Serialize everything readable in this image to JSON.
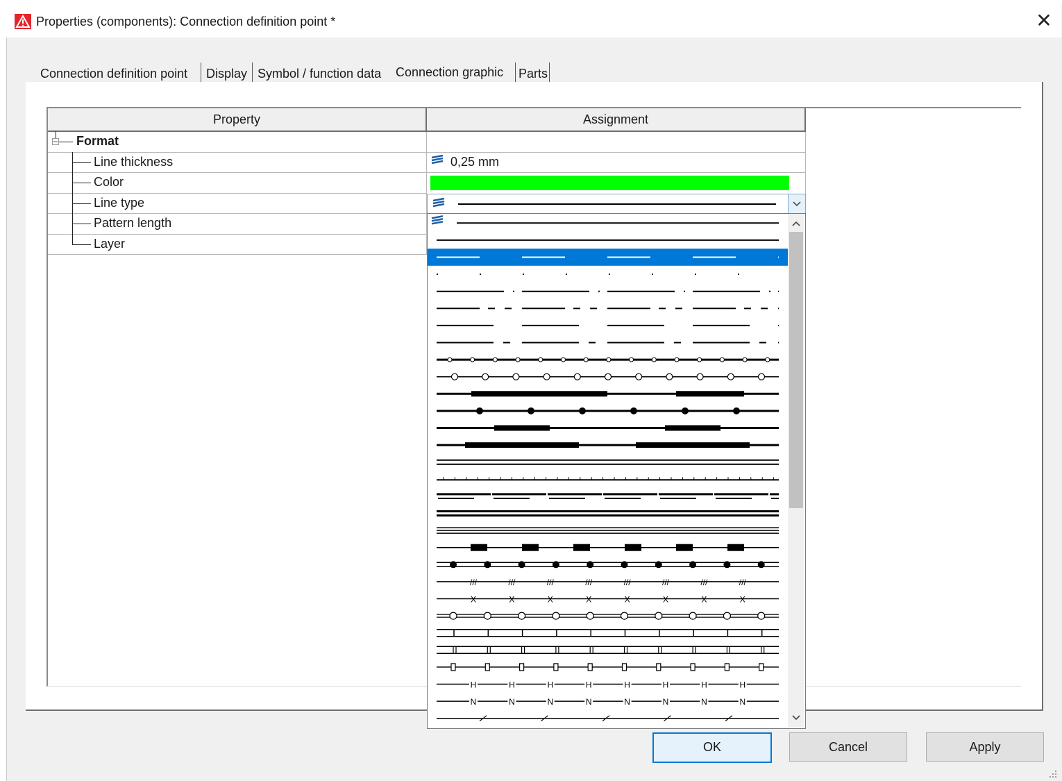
{
  "window": {
    "title": "Properties (components): Connection definition point *",
    "close_glyph": "✕",
    "app_icon": "warning-triangle-icon"
  },
  "tabs": [
    {
      "label": "Connection definition point",
      "active": false
    },
    {
      "label": "Display",
      "active": false
    },
    {
      "label": "Symbol / function data",
      "active": false
    },
    {
      "label": "Connection graphic",
      "active": true
    },
    {
      "label": "Parts",
      "active": false
    }
  ],
  "grid": {
    "headers": {
      "property": "Property",
      "assignment": "Assignment"
    },
    "group": {
      "label": "Format"
    },
    "rows": [
      {
        "label": "Line thickness",
        "value": "0,25 mm"
      },
      {
        "label": "Color",
        "value_color": "#00ff00"
      },
      {
        "label": "Line type",
        "value": ""
      },
      {
        "label": "Pattern length",
        "value": ""
      },
      {
        "label": "Layer",
        "value": ""
      }
    ]
  },
  "linetype_list": {
    "selected_index": 2,
    "items": [
      "layer-solid",
      "solid",
      "dashed",
      "dotted",
      "dash-dot",
      "dash-dot-dot",
      "long-dash",
      "long-dash-short",
      "circles-small",
      "circles-open",
      "thick-segments",
      "dots-filled",
      "thick-segments-2",
      "thick-segments-3",
      "double-line",
      "tick-line",
      "dashed-double",
      "double-solid",
      "triple-line",
      "block-dashes",
      "dots-line",
      "triple-slash",
      "x-marks",
      "circles-double",
      "box-ticks",
      "box-ticks-2",
      "box-open",
      "letter-H",
      "letter-N",
      "slashes"
    ],
    "item_letters": {
      "h": "H",
      "n": "N",
      "slash": "///",
      "x": "X"
    }
  },
  "buttons": {
    "ok": "OK",
    "cancel": "Cancel",
    "apply": "Apply"
  },
  "colors": {
    "selection": "#0078d7",
    "color_swatch": "#00ff00",
    "accent": "#0078d7"
  }
}
